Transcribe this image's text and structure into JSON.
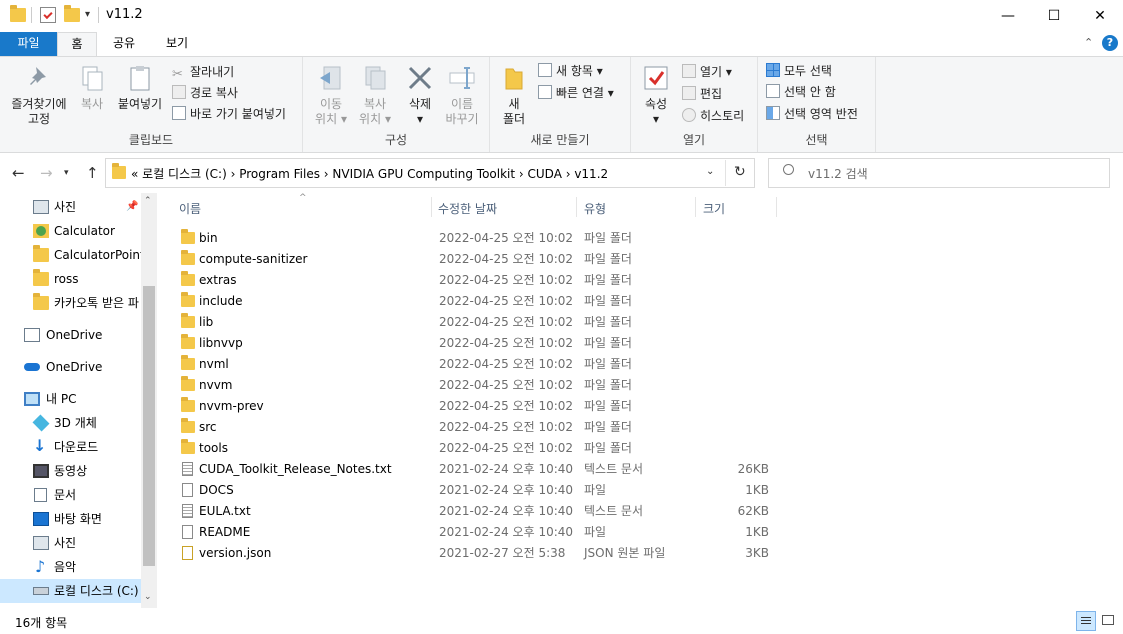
{
  "window": {
    "title": "v11.2",
    "controls": {
      "minimize": "—",
      "maximize": "☐",
      "close": "✕"
    }
  },
  "tabs": {
    "file": "파일",
    "home": "홈",
    "share": "공유",
    "view": "보기"
  },
  "ribbon": {
    "clipboard": {
      "label": "클립보드",
      "pin": "즐겨찾기에\n고정",
      "pin_line1": "즐겨찾기에",
      "pin_line2": "고정",
      "copy": "복사",
      "paste": "붙여넣기",
      "cut": "잘라내기",
      "copy_path": "경로 복사",
      "paste_shortcut": "바로 가기 붙여넣기"
    },
    "organize": {
      "label": "구성",
      "move_line1": "이동",
      "move_line2": "위치",
      "copyto_line1": "복사",
      "copyto_line2": "위치",
      "delete": "삭제",
      "rename_line1": "이름",
      "rename_line2": "바꾸기"
    },
    "new": {
      "label": "새로 만들기",
      "folder_line1": "새",
      "folder_line2": "폴더",
      "new_item": "새 항목",
      "easy_access": "빠른 연결"
    },
    "open": {
      "label": "열기",
      "properties": "속성",
      "open": "열기",
      "edit": "편집",
      "history": "히스토리"
    },
    "select": {
      "label": "선택",
      "select_all": "모두 선택",
      "select_none": "선택 안 함",
      "invert": "선택 영역 반전"
    }
  },
  "address": {
    "path": "«  로컬 디스크 (C:)  ›  Program Files  ›  NVIDIA GPU Computing Toolkit  ›  CUDA  ›  v11.2",
    "search_placeholder": "v11.2 검색"
  },
  "nav_pane": [
    {
      "label": "사진",
      "icon": "pictures-icon"
    },
    {
      "label": "Calculator",
      "icon": "calculator-folder-icon"
    },
    {
      "label": "CalculatorPointe",
      "icon": "folder-icon"
    },
    {
      "label": "ross",
      "icon": "folder-icon"
    },
    {
      "label": "카카오톡 받은 파",
      "icon": "folder-icon"
    },
    {
      "label": "OneDrive",
      "icon": "onedrive-icon"
    },
    {
      "label": "OneDrive",
      "icon": "cloud-icon"
    },
    {
      "label": "내 PC",
      "icon": "pc-icon"
    },
    {
      "label": "3D 개체",
      "icon": "3d-objects-icon"
    },
    {
      "label": "다운로드",
      "icon": "download-icon"
    },
    {
      "label": "동영상",
      "icon": "video-icon"
    },
    {
      "label": "문서",
      "icon": "documents-icon"
    },
    {
      "label": "바탕 화면",
      "icon": "desktop-icon"
    },
    {
      "label": "사진",
      "icon": "pictures-icon"
    },
    {
      "label": "음악",
      "icon": "music-icon"
    },
    {
      "label": "로컬 디스크 (C:)",
      "icon": "drive-icon"
    }
  ],
  "columns": {
    "name": "이름",
    "modified": "수정한 날짜",
    "type": "유형",
    "size": "크기"
  },
  "files": [
    {
      "name": "bin",
      "modified": "2022-04-25 오전 10:02",
      "type": "파일 폴더",
      "size": "",
      "kind": "folder"
    },
    {
      "name": "compute-sanitizer",
      "modified": "2022-04-25 오전 10:02",
      "type": "파일 폴더",
      "size": "",
      "kind": "folder"
    },
    {
      "name": "extras",
      "modified": "2022-04-25 오전 10:02",
      "type": "파일 폴더",
      "size": "",
      "kind": "folder"
    },
    {
      "name": "include",
      "modified": "2022-04-25 오전 10:02",
      "type": "파일 폴더",
      "size": "",
      "kind": "folder"
    },
    {
      "name": "lib",
      "modified": "2022-04-25 오전 10:02",
      "type": "파일 폴더",
      "size": "",
      "kind": "folder"
    },
    {
      "name": "libnvvp",
      "modified": "2022-04-25 오전 10:02",
      "type": "파일 폴더",
      "size": "",
      "kind": "folder"
    },
    {
      "name": "nvml",
      "modified": "2022-04-25 오전 10:02",
      "type": "파일 폴더",
      "size": "",
      "kind": "folder"
    },
    {
      "name": "nvvm",
      "modified": "2022-04-25 오전 10:02",
      "type": "파일 폴더",
      "size": "",
      "kind": "folder"
    },
    {
      "name": "nvvm-prev",
      "modified": "2022-04-25 오전 10:02",
      "type": "파일 폴더",
      "size": "",
      "kind": "folder"
    },
    {
      "name": "src",
      "modified": "2022-04-25 오전 10:02",
      "type": "파일 폴더",
      "size": "",
      "kind": "folder"
    },
    {
      "name": "tools",
      "modified": "2022-04-25 오전 10:02",
      "type": "파일 폴더",
      "size": "",
      "kind": "folder"
    },
    {
      "name": "CUDA_Toolkit_Release_Notes.txt",
      "modified": "2021-02-24 오후 10:40",
      "type": "텍스트 문서",
      "size": "26KB",
      "kind": "text"
    },
    {
      "name": "DOCS",
      "modified": "2021-02-24 오후 10:40",
      "type": "파일",
      "size": "1KB",
      "kind": "file"
    },
    {
      "name": "EULA.txt",
      "modified": "2021-02-24 오후 10:40",
      "type": "텍스트 문서",
      "size": "62KB",
      "kind": "text"
    },
    {
      "name": "README",
      "modified": "2021-02-24 오후 10:40",
      "type": "파일",
      "size": "1KB",
      "kind": "file"
    },
    {
      "name": "version.json",
      "modified": "2021-02-27 오전 5:38",
      "type": "JSON 원본 파일",
      "size": "3KB",
      "kind": "json"
    }
  ],
  "status": {
    "item_count": "16개 항목"
  },
  "colors": {
    "file_tab": "#1979ca",
    "folder": "#f4c84a",
    "ribbon_bg": "#f5f6f7",
    "header_text": "#4c607a"
  }
}
